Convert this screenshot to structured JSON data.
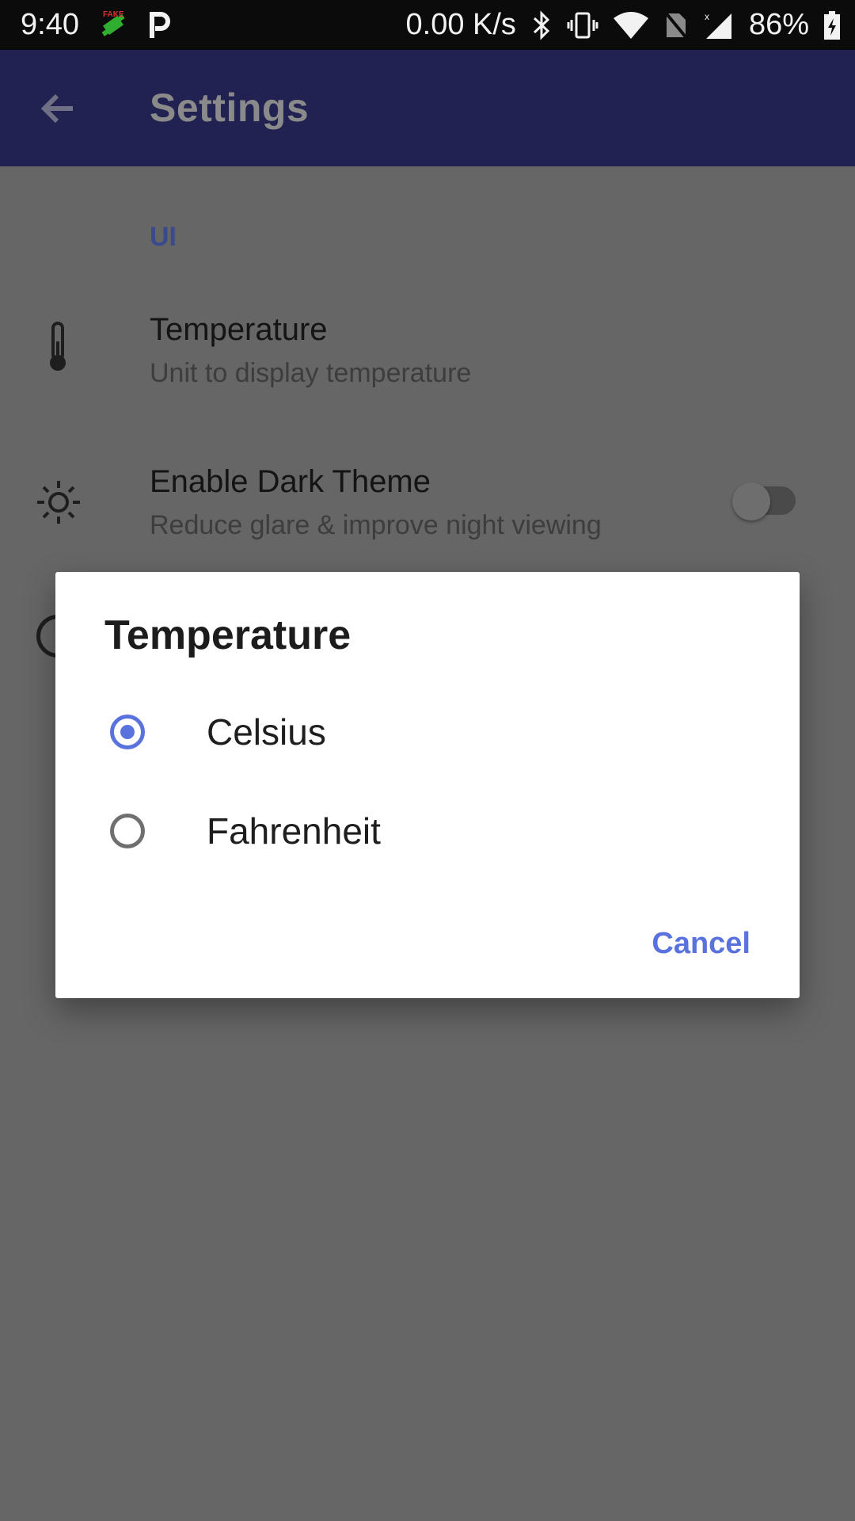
{
  "status_bar": {
    "time": "9:40",
    "net_speed": "0.00 K/s",
    "battery": "86%",
    "icons": [
      "fake-gps-icon",
      "parking-p-icon",
      "bluetooth-icon",
      "vibrate-icon",
      "wifi-icon",
      "no-sim-icon",
      "signal-icon",
      "battery-charging-icon"
    ]
  },
  "app_bar": {
    "title": "Settings",
    "back_icon": "arrow-back-icon"
  },
  "content": {
    "section_label": "UI",
    "temperature": {
      "title": "Temperature",
      "subtitle": "Unit to display temperature",
      "icon": "thermometer-icon"
    },
    "dark_theme": {
      "title": "Enable Dark Theme",
      "subtitle": "Reduce glare & improve night viewing",
      "icon": "sun-icon",
      "enabled": false
    }
  },
  "dialog": {
    "title": "Temperature",
    "options": [
      {
        "label": "Celsius",
        "selected": true
      },
      {
        "label": "Fahrenheit",
        "selected": false
      }
    ],
    "cancel_label": "Cancel",
    "accent": "#5a72de"
  },
  "colors": {
    "app_bar": "#212152",
    "scrim_background": "#666666",
    "accent": "#5a72de"
  }
}
